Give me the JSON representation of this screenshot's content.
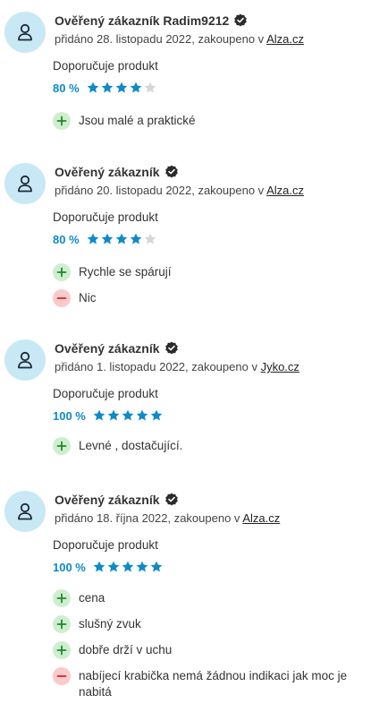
{
  "colors": {
    "accent": "#0e8ac8",
    "star_filled": "#0e8ac8",
    "star_empty": "#d6d6d6",
    "avatar_bg": "#c8e8f6",
    "pro_bg": "#cfeecf",
    "pro_fg": "#1f8a2e",
    "con_bg": "#f9caca",
    "con_fg": "#d4242a"
  },
  "reviews": [
    {
      "author": "Ověřený zákazník Radim9212",
      "added_prefix": "přidáno 28. listopadu 2022, zakoupeno v ",
      "shop": "Alza.cz",
      "recommend": "Doporučuje produkt",
      "rating_label": "80 %",
      "stars": 4,
      "pros": [
        "Jsou malé a praktické"
      ],
      "cons": []
    },
    {
      "author": "Ověřený zákazník",
      "added_prefix": "přidáno 20. listopadu 2022, zakoupeno v ",
      "shop": "Alza.cz",
      "recommend": "Doporučuje produkt",
      "rating_label": "80 %",
      "stars": 4,
      "pros": [
        "Rychle se spárují"
      ],
      "cons": [
        "Nic"
      ]
    },
    {
      "author": "Ověřený zákazník",
      "added_prefix": "přidáno 1. listopadu 2022, zakoupeno v ",
      "shop": "Jyko.cz",
      "recommend": "Doporučuje produkt",
      "rating_label": "100 %",
      "stars": 5,
      "pros": [
        "Levné , dostačující."
      ],
      "cons": []
    },
    {
      "author": "Ověřený zákazník",
      "added_prefix": "přidáno 18. října 2022, zakoupeno v ",
      "shop": "Alza.cz",
      "recommend": "Doporučuje produkt",
      "rating_label": "100 %",
      "stars": 5,
      "pros": [
        "cena",
        "slušný zvuk",
        "dobře drží v uchu"
      ],
      "cons": [
        "nabíjecí krabička nemá žádnou indikaci jak moc je nabitá"
      ]
    }
  ]
}
